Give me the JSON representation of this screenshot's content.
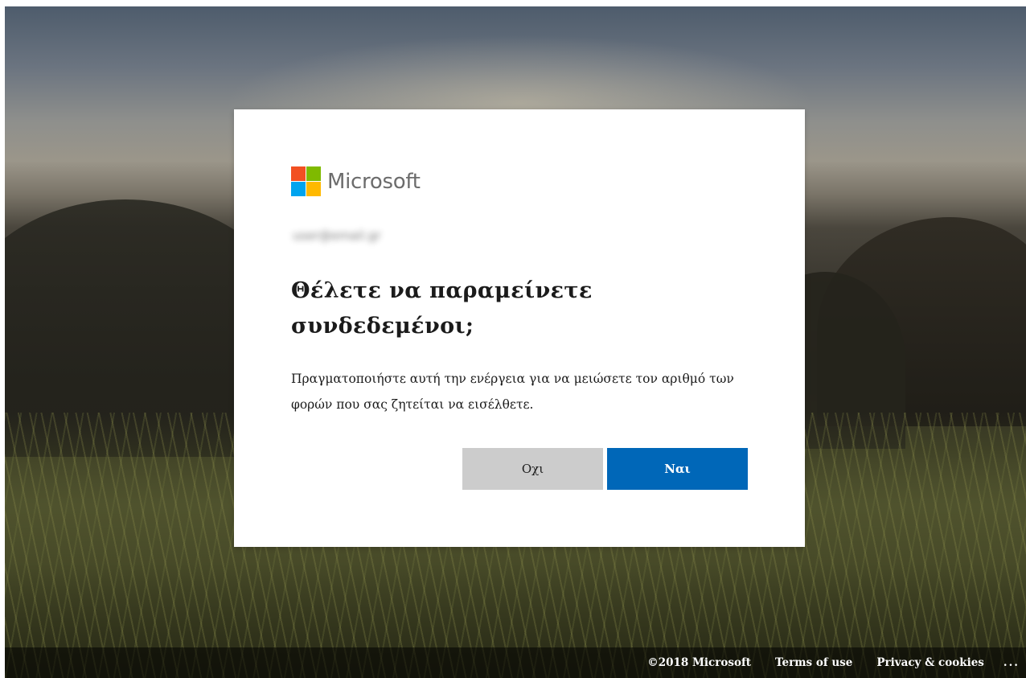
{
  "brand": {
    "name": "Microsoft",
    "logo_colors": [
      "#f25022",
      "#7fba00",
      "#00a4ef",
      "#ffb900"
    ]
  },
  "dialog": {
    "account": "user@email.gr",
    "title": "Θέλετε να παραμείνετε συνδεδεμένοι;",
    "description": "Πραγματοποιήστε αυτή την ενέργεια για να μειώσετε τον αριθμό των φορών που σας ζητείται να εισέλθετε.",
    "no_label": "Οχι",
    "yes_label": "Ναι",
    "accent_color": "#0067b8"
  },
  "footer": {
    "copyright": "©2018 Microsoft",
    "terms": "Terms of use",
    "privacy": "Privacy & cookies",
    "more": "..."
  }
}
